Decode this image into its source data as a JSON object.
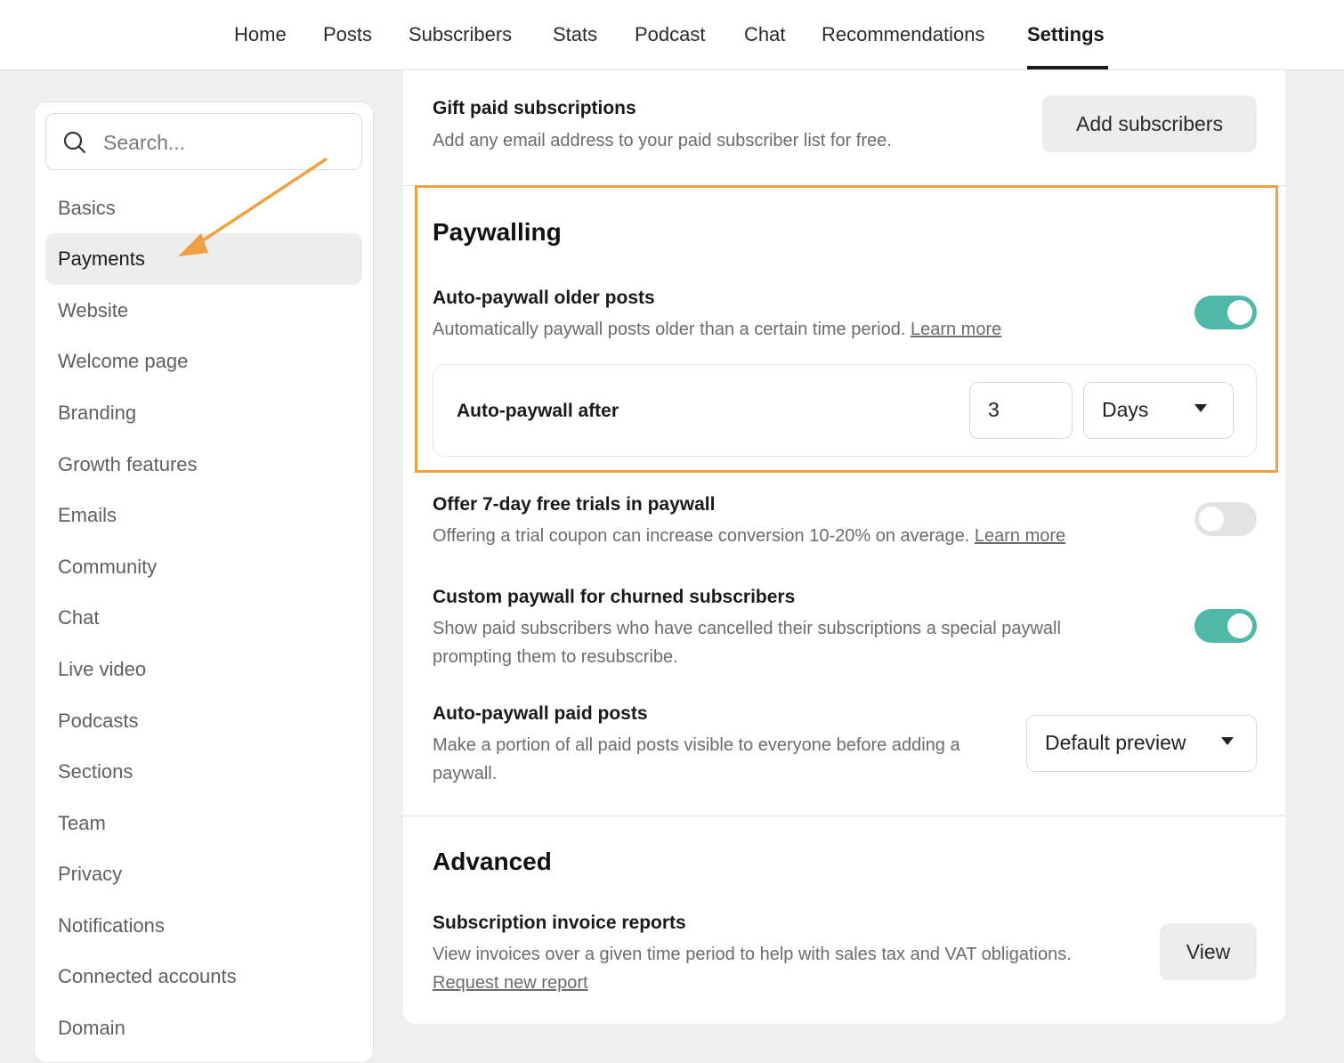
{
  "topnav": {
    "tabs": [
      {
        "label": "Home"
      },
      {
        "label": "Posts"
      },
      {
        "label": "Subscribers"
      },
      {
        "label": "Stats"
      },
      {
        "label": "Podcast"
      },
      {
        "label": "Chat"
      },
      {
        "label": "Recommendations"
      },
      {
        "label": "Settings",
        "active": true
      }
    ]
  },
  "sidebar": {
    "search_placeholder": "Search...",
    "items": [
      {
        "label": "Basics"
      },
      {
        "label": "Payments",
        "active": true
      },
      {
        "label": "Website"
      },
      {
        "label": "Welcome page"
      },
      {
        "label": "Branding"
      },
      {
        "label": "Growth features"
      },
      {
        "label": "Emails"
      },
      {
        "label": "Community"
      },
      {
        "label": "Chat"
      },
      {
        "label": "Live video"
      },
      {
        "label": "Podcasts"
      },
      {
        "label": "Sections"
      },
      {
        "label": "Team"
      },
      {
        "label": "Privacy"
      },
      {
        "label": "Notifications"
      },
      {
        "label": "Connected accounts"
      },
      {
        "label": "Domain"
      }
    ]
  },
  "gift": {
    "title": "Gift paid subscriptions",
    "desc": "Add any email address to your paid subscriber list for free.",
    "button": "Add subscribers"
  },
  "paywalling": {
    "heading": "Paywalling",
    "auto_older": {
      "title": "Auto-paywall older posts",
      "desc": "Automatically paywall posts older than a certain time period.",
      "link": "Learn more",
      "enabled": true
    },
    "auto_after": {
      "label": "Auto-paywall after",
      "value": "3",
      "unit": "Days"
    },
    "free_trials": {
      "title": "Offer 7-day free trials in paywall",
      "desc": "Offering a trial coupon can increase conversion 10-20% on average.",
      "link": "Learn more",
      "enabled": false
    },
    "churned": {
      "title": "Custom paywall for churned subscribers",
      "desc": "Show paid subscribers who have cancelled their subscriptions a special paywall prompting them to resubscribe.",
      "enabled": true
    },
    "paid_posts": {
      "title": "Auto-paywall paid posts",
      "desc": "Make a portion of all paid posts visible to everyone before adding a paywall.",
      "select": "Default preview"
    }
  },
  "advanced": {
    "heading": "Advanced",
    "invoice": {
      "title": "Subscription invoice reports",
      "desc": "View invoices over a given time period to help with sales tax and VAT obligations.",
      "link": "Request new report",
      "button": "View"
    }
  },
  "colors": {
    "accent_toggle": "#4fb8a8",
    "highlight": "#f0a040"
  }
}
